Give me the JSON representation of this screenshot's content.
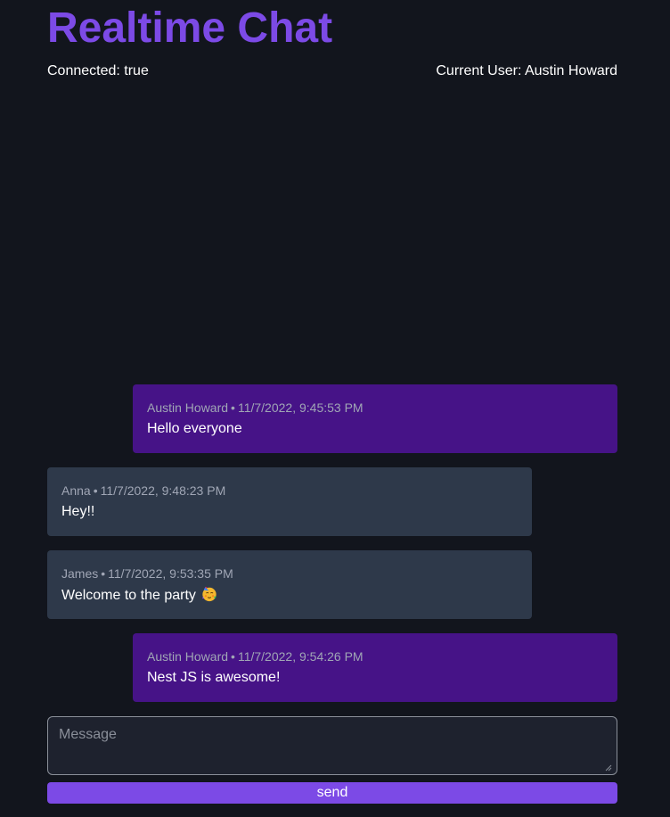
{
  "header": {
    "title": "Realtime Chat",
    "connected": "Connected: true",
    "current_user": "Current User: Austin Howard"
  },
  "messages": [
    {
      "author": "Austin Howard",
      "separator": "•",
      "timestamp": "11/7/2022, 9:45:53 PM",
      "text": "Hello everyone",
      "is_self": true
    },
    {
      "author": "Anna",
      "separator": "•",
      "timestamp": "11/7/2022, 9:48:23 PM",
      "text": "Hey!!",
      "is_self": false
    },
    {
      "author": "James",
      "separator": "•",
      "timestamp": "11/7/2022, 9:53:35 PM",
      "text": "Welcome to the party",
      "emoji": "partying-face-icon",
      "is_self": false
    },
    {
      "author": "Austin Howard",
      "separator": "•",
      "timestamp": "11/7/2022, 9:54:26 PM",
      "text": "Nest JS is awesome!",
      "is_self": true
    }
  ],
  "composer": {
    "placeholder": "Message",
    "value": ""
  },
  "send_button": {
    "label": "send"
  },
  "colors": {
    "background": "#12151d",
    "accent": "#7c4ae6",
    "self_bubble": "#461387",
    "other_bubble": "#2e394a",
    "meta_text": "#a0a6b5"
  }
}
